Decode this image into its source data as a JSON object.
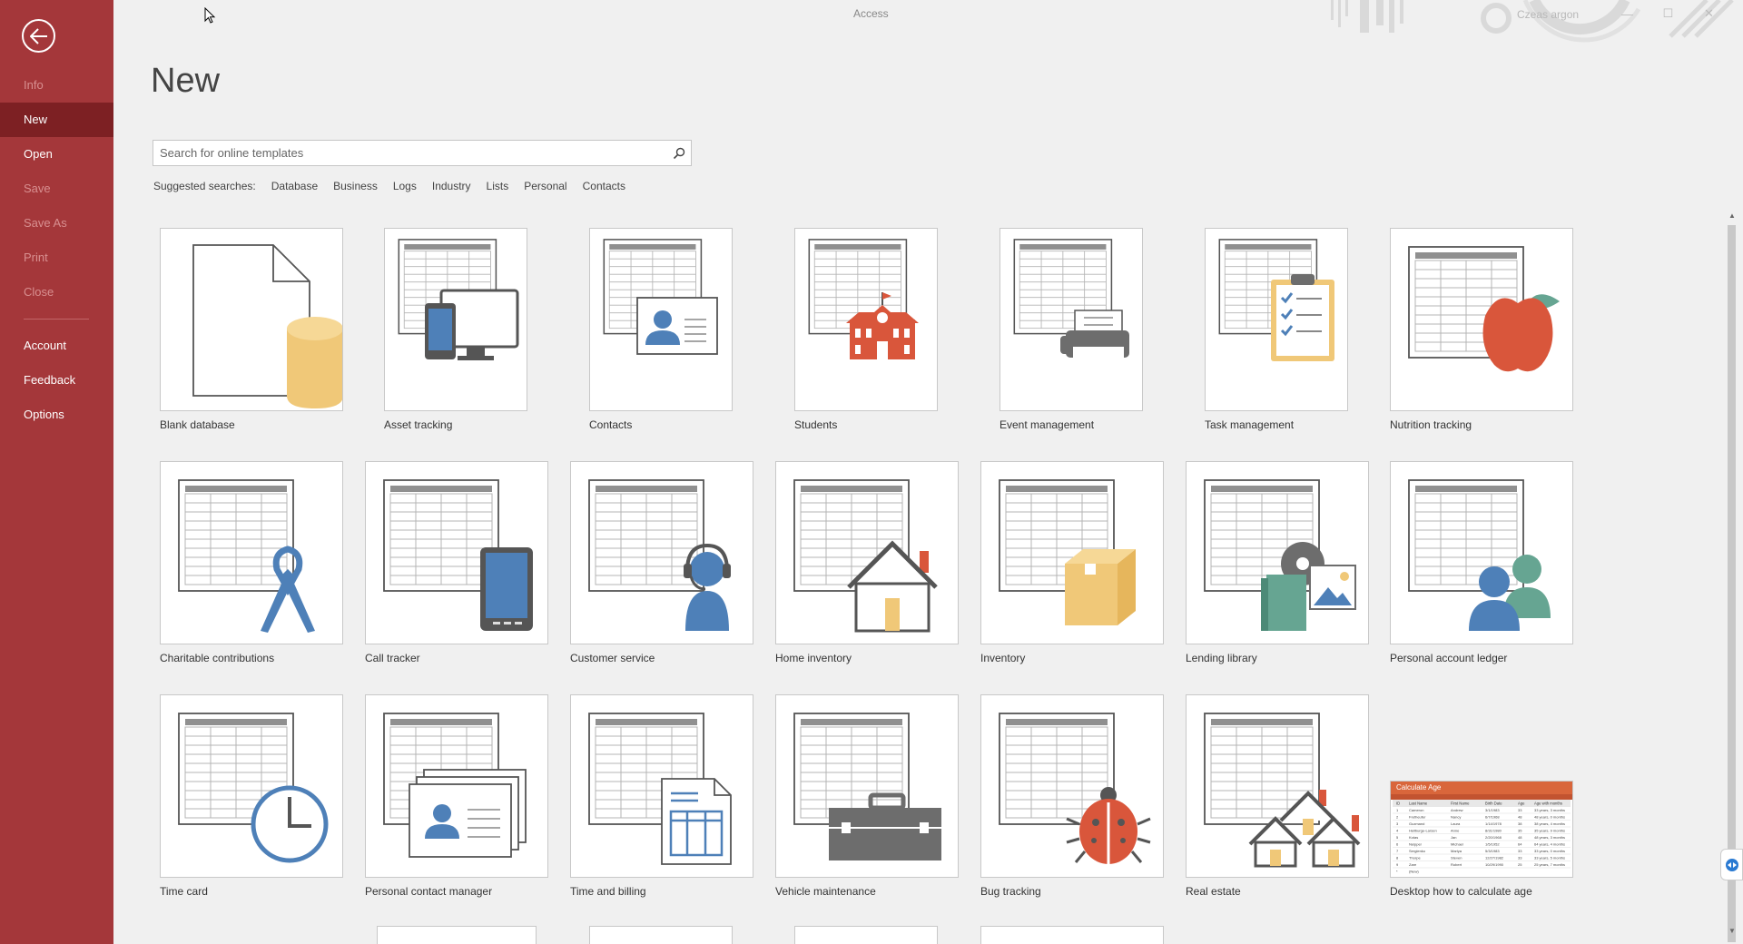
{
  "window": {
    "app_title": "Access",
    "user_name": "Czeas argon",
    "minimize": "—",
    "maximize": "☐",
    "close": "✕"
  },
  "sidebar": {
    "items": [
      {
        "label": "Info",
        "state": "disabled"
      },
      {
        "label": "New",
        "state": "active"
      },
      {
        "label": "Open",
        "state": "normal"
      },
      {
        "label": "Save",
        "state": "disabled"
      },
      {
        "label": "Save As",
        "state": "disabled"
      },
      {
        "label": "Print",
        "state": "disabled"
      },
      {
        "label": "Close",
        "state": "disabled"
      }
    ],
    "bottom_items": [
      {
        "label": "Account"
      },
      {
        "label": "Feedback"
      },
      {
        "label": "Options"
      }
    ]
  },
  "main": {
    "title": "New",
    "search": {
      "placeholder": "Search for online templates"
    },
    "suggested": {
      "label": "Suggested searches:",
      "links": [
        "Database",
        "Business",
        "Logs",
        "Industry",
        "Lists",
        "Personal",
        "Contacts"
      ]
    }
  },
  "templates": [
    {
      "label": "Blank database",
      "icon": "blank-database-icon"
    },
    {
      "label": "Asset tracking",
      "icon": "computer-icon"
    },
    {
      "label": "Contacts",
      "icon": "contact-card-icon"
    },
    {
      "label": "Students",
      "icon": "school-icon"
    },
    {
      "label": "Event management",
      "icon": "printer-icon"
    },
    {
      "label": "Task management",
      "icon": "clipboard-icon"
    },
    {
      "label": "Nutrition tracking",
      "icon": "apple-icon"
    },
    {
      "label": "Charitable contributions",
      "icon": "ribbon-icon"
    },
    {
      "label": "Call tracker",
      "icon": "phone-icon"
    },
    {
      "label": "Customer service",
      "icon": "headset-icon"
    },
    {
      "label": "Home inventory",
      "icon": "house-icon"
    },
    {
      "label": "Inventory",
      "icon": "box-icon"
    },
    {
      "label": "Lending library",
      "icon": "media-icon"
    },
    {
      "label": "Personal account ledger",
      "icon": "people-icon"
    },
    {
      "label": "Time card",
      "icon": "clock-icon"
    },
    {
      "label": "Personal contact manager",
      "icon": "contact-cards-icon"
    },
    {
      "label": "Time and billing",
      "icon": "invoice-icon"
    },
    {
      "label": "Vehicle maintenance",
      "icon": "toolbox-icon"
    },
    {
      "label": "Bug tracking",
      "icon": "bug-icon"
    },
    {
      "label": "Real estate",
      "icon": "houses-icon"
    },
    {
      "label": "Desktop how to calculate age",
      "icon": "spreadsheet-preview"
    }
  ],
  "calc_age_preview": {
    "title": "Calculate Age",
    "headers": [
      "ID",
      "Last Name",
      "First Name",
      "Birth Date",
      "Age",
      "Age with months"
    ],
    "rows": [
      [
        "1",
        "Cameron",
        "Andrew",
        "3/1/1983",
        "33",
        "33 years, 3 months"
      ],
      [
        "2",
        "Fretheufer",
        "Nancy",
        "6/7/1968",
        "48",
        "48 years, 0 months"
      ],
      [
        "3",
        "Guzmand",
        "Laura",
        "1/14/1978",
        "38",
        "38 years, 4 months"
      ],
      [
        "4",
        "Heilburge-Larsen",
        "Anne",
        "8/31/1980",
        "35",
        "35 years, 9 months"
      ],
      [
        "5",
        "Kotas",
        "Jan",
        "2/20/1968",
        "48",
        "48 years, 3 months"
      ],
      [
        "6",
        "Neipper",
        "Michael",
        "1/5/1952",
        "64",
        "64 years, 4 months"
      ],
      [
        "7",
        "Sergienko",
        "Mariya",
        "5/3/1983",
        "33",
        "33 years, 0 months"
      ],
      [
        "8",
        "Thorpe",
        "Steven",
        "12/27/1982",
        "33",
        "33 years, 5 months"
      ],
      [
        "9",
        "Zare",
        "Robert",
        "10/29/1990",
        "25",
        "25 years, 7 months"
      ],
      [
        "*",
        "(New)",
        "",
        "",
        "",
        ""
      ]
    ]
  },
  "colors": {
    "sidebar": "#a4373a",
    "sidebar_active": "#7d2023",
    "accent_blue": "#4e80b8",
    "accent_orange": "#f0c878",
    "accent_red": "#d9563b",
    "accent_teal": "#66a592"
  }
}
